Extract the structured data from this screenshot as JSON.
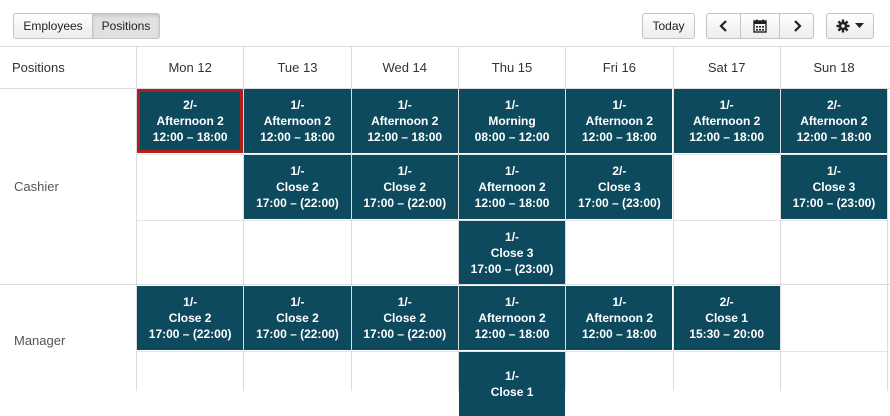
{
  "toolbar": {
    "view_tabs": [
      "Employees",
      "Positions"
    ],
    "active_tab": "Positions",
    "today_label": "Today",
    "prev_icon": "chevron-left-icon",
    "calendar_icon": "calendar-icon",
    "next_icon": "chevron-right-icon",
    "settings_icon": "gear-icon"
  },
  "calendar": {
    "corner_label": "Positions",
    "days": [
      "Mon 12",
      "Tue 13",
      "Wed 14",
      "Thu 15",
      "Fri 16",
      "Sat 17",
      "Sun 18"
    ],
    "rows": [
      {
        "position": "Cashier",
        "shifts": [
          {
            "day": 0,
            "slot": 0,
            "count": "2/-",
            "name": "Afternoon 2",
            "time": "12:00 – 18:00",
            "selected": true
          },
          {
            "day": 1,
            "slot": 0,
            "count": "1/-",
            "name": "Afternoon 2",
            "time": "12:00 – 18:00"
          },
          {
            "day": 1,
            "slot": 1,
            "count": "1/-",
            "name": "Close 2",
            "time": "17:00 – (22:00)"
          },
          {
            "day": 2,
            "slot": 0,
            "count": "1/-",
            "name": "Afternoon 2",
            "time": "12:00 – 18:00"
          },
          {
            "day": 2,
            "slot": 1,
            "count": "1/-",
            "name": "Close 2",
            "time": "17:00 – (22:00)"
          },
          {
            "day": 3,
            "slot": 0,
            "count": "1/-",
            "name": "Morning",
            "time": "08:00 – 12:00"
          },
          {
            "day": 3,
            "slot": 1,
            "count": "1/-",
            "name": "Afternoon 2",
            "time": "12:00 – 18:00"
          },
          {
            "day": 3,
            "slot": 2,
            "count": "1/-",
            "name": "Close 3",
            "time": "17:00 – (23:00)"
          },
          {
            "day": 4,
            "slot": 0,
            "count": "1/-",
            "name": "Afternoon 2",
            "time": "12:00 – 18:00"
          },
          {
            "day": 4,
            "slot": 1,
            "count": "2/-",
            "name": "Close 3",
            "time": "17:00 – (23:00)"
          },
          {
            "day": 5,
            "slot": 0,
            "count": "1/-",
            "name": "Afternoon 2",
            "time": "12:00 – 18:00"
          },
          {
            "day": 6,
            "slot": 0,
            "count": "2/-",
            "name": "Afternoon 2",
            "time": "12:00 – 18:00"
          },
          {
            "day": 6,
            "slot": 1,
            "count": "1/-",
            "name": "Close 3",
            "time": "17:00 – (23:00)"
          }
        ]
      },
      {
        "position": "Manager",
        "shifts": [
          {
            "day": 0,
            "slot": 0,
            "count": "1/-",
            "name": "Close 2",
            "time": "17:00 – (22:00)"
          },
          {
            "day": 1,
            "slot": 0,
            "count": "1/-",
            "name": "Close 2",
            "time": "17:00 – (22:00)"
          },
          {
            "day": 2,
            "slot": 0,
            "count": "1/-",
            "name": "Close 2",
            "time": "17:00 – (22:00)"
          },
          {
            "day": 3,
            "slot": 0,
            "count": "1/-",
            "name": "Afternoon 2",
            "time": "12:00 – 18:00"
          },
          {
            "day": 3,
            "slot": 1,
            "count": "1/-",
            "name": "Close 1",
            "time": ""
          },
          {
            "day": 4,
            "slot": 0,
            "count": "1/-",
            "name": "Afternoon 2",
            "time": "12:00 – 18:00"
          },
          {
            "day": 5,
            "slot": 0,
            "count": "2/-",
            "name": "Close 1",
            "time": "15:30 – 20:00"
          }
        ]
      }
    ]
  }
}
